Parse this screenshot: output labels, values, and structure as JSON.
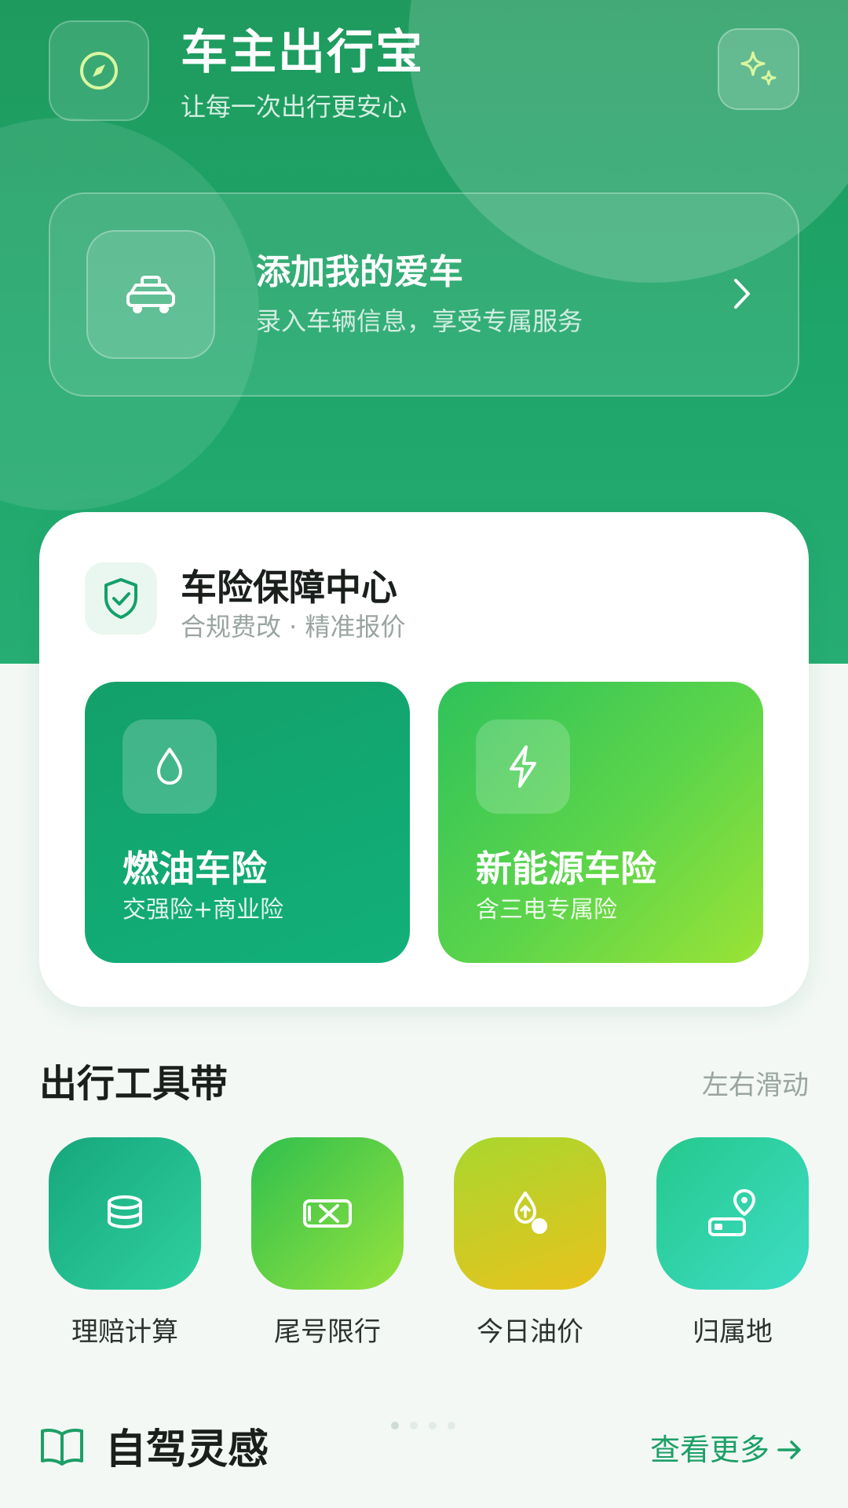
{
  "header": {
    "app_title": "车主出行宝",
    "app_subtitle": "让每一次出行更安心",
    "logo_icon": "compass-icon",
    "action_icon": "sparkles-icon"
  },
  "add_car": {
    "title": "添加我的爱车",
    "subtitle": "录入车辆信息，享受专属服务",
    "icon": "car-icon"
  },
  "insurance": {
    "title": "车险保障中心",
    "subtitle": "合规费改 · 精准报价",
    "icon": "shield-check-icon",
    "tiles": [
      {
        "title": "燃油车险",
        "subtitle": "交强险+商业险",
        "icon": "droplet-icon"
      },
      {
        "title": "新能源车险",
        "subtitle": "含三电专属险",
        "icon": "lightning-icon"
      }
    ]
  },
  "tools": {
    "title": "出行工具带",
    "hint": "左右滑动",
    "items": [
      {
        "label": "理赔计算",
        "icon": "coin-stack-icon"
      },
      {
        "label": "尾号限行",
        "icon": "plate-ban-icon"
      },
      {
        "label": "今日油价",
        "icon": "fuel-drop-icon"
      },
      {
        "label": "归属地",
        "icon": "plate-location-icon"
      }
    ],
    "pager": {
      "count": 4,
      "active": 0
    }
  },
  "inspiration": {
    "title": "自驾灵感",
    "more_label": "查看更多",
    "icon": "book-icon"
  },
  "colors": {
    "brand_green": "#1f9a5e",
    "accent_link": "#1d9f67",
    "tile_fuel": "#13a06a",
    "tile_ev": "#5dd54a"
  }
}
